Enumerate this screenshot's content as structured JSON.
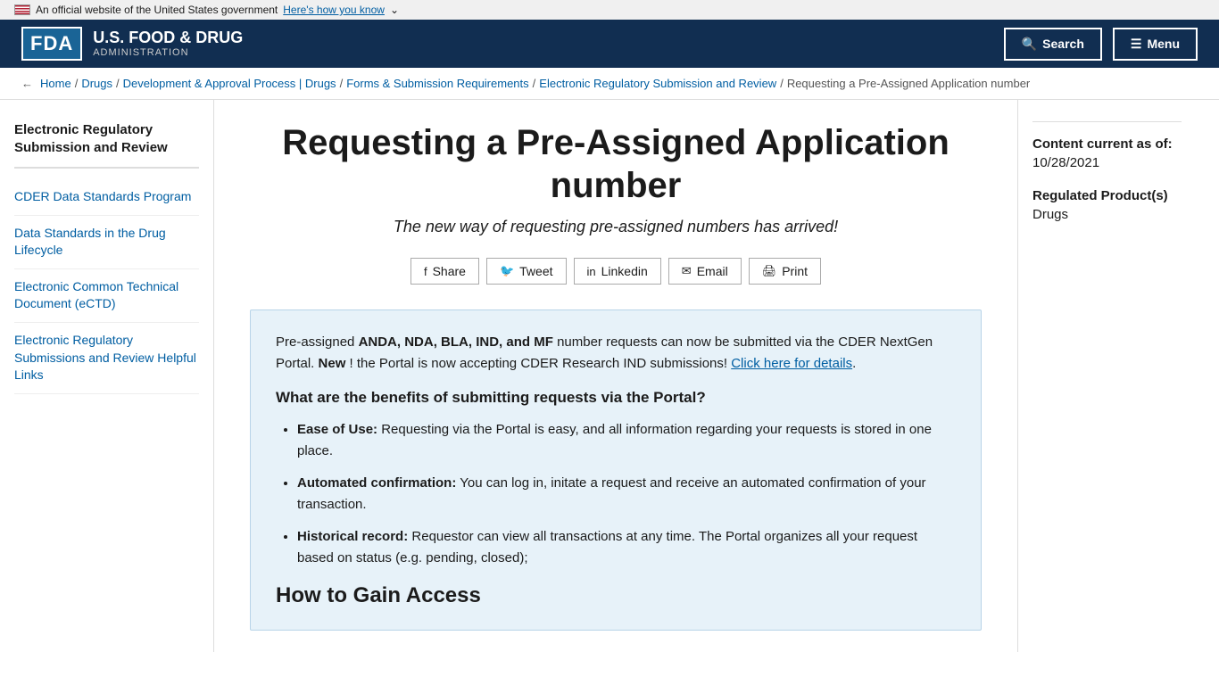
{
  "gov_banner": {
    "text": "An official website of the United States government",
    "link_text": "Here's how you know"
  },
  "header": {
    "fda_badge": "FDA",
    "agency_name": "U.S. FOOD & DRUG",
    "department": "ADMINISTRATION",
    "search_label": "Search",
    "menu_label": "Menu"
  },
  "breadcrumb": {
    "items": [
      {
        "label": "Home",
        "href": "#"
      },
      {
        "label": "Drugs",
        "href": "#"
      },
      {
        "label": "Development & Approval Process | Drugs",
        "href": "#"
      },
      {
        "label": "Forms & Submission Requirements",
        "href": "#"
      },
      {
        "label": "Electronic Regulatory Submission and Review",
        "href": "#"
      },
      {
        "label": "Requesting a Pre-Assigned Application number",
        "href": "#"
      }
    ]
  },
  "page": {
    "title": "Requesting a Pre-Assigned Application number",
    "subtitle": "The new way of requesting pre-assigned numbers has arrived!"
  },
  "share_bar": {
    "share_label": "Share",
    "tweet_label": "Tweet",
    "linkedin_label": "Linkedin",
    "email_label": "Email",
    "print_label": "Print"
  },
  "content_box": {
    "intro_text_1": "Pre-assigned ",
    "bold_types": "ANDA, NDA, BLA, IND, and MF",
    "intro_text_2": " number requests can now be submitted via the CDER NextGen Portal. ",
    "new_bold": "New",
    "intro_text_3": "! the Portal is now accepting CDER Research IND submissions! ",
    "link_text": "Click here for details",
    "benefits_heading": "What are the benefits of submitting requests via the Portal?",
    "benefits": [
      {
        "bold": "Ease of Use:",
        "text": " Requesting via the Portal is easy, and all information regarding your requests is stored in one place."
      },
      {
        "bold": "Automated confirmation:",
        "text": " You can log in, initate a request and receive an automated confirmation of your transaction."
      },
      {
        "bold": "Historical record:",
        "text": " Requestor can view all transactions at any time. The Portal organizes all your request based on status (e.g. pending, closed);"
      }
    ],
    "access_heading": "How to Gain Access"
  },
  "sidebar": {
    "title": "Electronic Regulatory Submission and Review",
    "nav_items": [
      {
        "label": "CDER Data Standards Program",
        "href": "#"
      },
      {
        "label": "Data Standards in the Drug Lifecycle",
        "href": "#"
      },
      {
        "label": "Electronic Common Technical Document (eCTD)",
        "href": "#"
      },
      {
        "label": "Electronic Regulatory Submissions and Review Helpful Links",
        "href": "#"
      }
    ]
  },
  "right_sidebar": {
    "content_date_label": "Content current as of:",
    "content_date": "10/28/2021",
    "regulated_label": "Regulated Product(s)",
    "regulated_value": "Drugs"
  }
}
